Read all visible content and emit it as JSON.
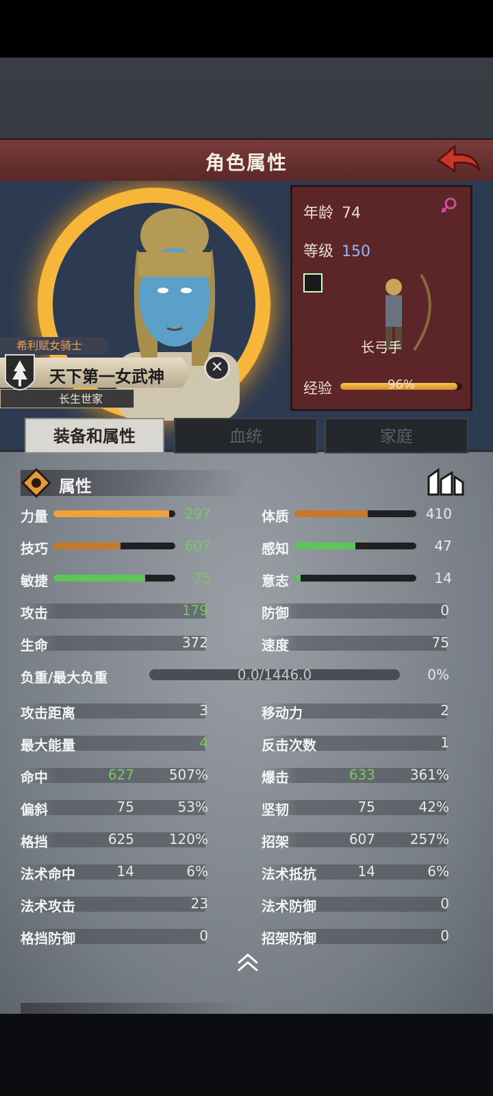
{
  "header": {
    "title": "角色属性"
  },
  "info": {
    "age_label": "年龄",
    "age": "74",
    "level_label": "等级",
    "level": "150",
    "class": "长弓手",
    "exp_label": "经验",
    "exp_text": "96%",
    "exp_fraction": 0.96
  },
  "character": {
    "title": "希利赋女骑士",
    "name": "天下第一女武神",
    "family": "长生世家"
  },
  "tabs": [
    "装备和属性",
    "血统",
    "家庭"
  ],
  "section": {
    "title": "属性"
  },
  "stats_bars": [
    {
      "label": "力量",
      "value": "297",
      "fill": 0.95,
      "color": "#f0a23a",
      "value_color": "green"
    },
    {
      "label": "体质",
      "value": "410",
      "fill": 0.6,
      "color": "#c47a2a",
      "value_color": "light"
    },
    {
      "label": "技巧",
      "value": "607",
      "fill": 0.55,
      "color": "#c47a2a",
      "value_color": "green"
    },
    {
      "label": "感知",
      "value": "47",
      "fill": 0.5,
      "color": "#5fc45a",
      "value_color": "light"
    },
    {
      "label": "敏捷",
      "value": "75",
      "fill": 0.75,
      "color": "#5fc45a",
      "value_color": "green"
    },
    {
      "label": "意志",
      "value": "14",
      "fill": 0.05,
      "color": "#5fc45a",
      "value_color": "light"
    }
  ],
  "stats_simple": [
    {
      "label": "攻击",
      "value": "179",
      "value_color": "green"
    },
    {
      "label": "防御",
      "value": "0",
      "value_color": "light"
    },
    {
      "label": "生命",
      "value": "372",
      "value_color": "light"
    },
    {
      "label": "速度",
      "value": "75",
      "value_color": "light"
    }
  ],
  "weight": {
    "label": "负重/最大负重",
    "value": "0.0/1446.0",
    "percent": "0%"
  },
  "stats_simple2": [
    {
      "label": "攻击距离",
      "value": "3",
      "value_color": "light"
    },
    {
      "label": "移动力",
      "value": "2",
      "value_color": "light"
    },
    {
      "label": "最大能量",
      "value": "4",
      "value_color": "green"
    },
    {
      "label": "反击次数",
      "value": "1",
      "value_color": "light"
    }
  ],
  "stats_pct": [
    {
      "label": "命中",
      "value": "627",
      "pct": "507%",
      "value_color": "green"
    },
    {
      "label": "爆击",
      "value": "633",
      "pct": "361%",
      "value_color": "green"
    },
    {
      "label": "偏斜",
      "value": "75",
      "pct": "53%",
      "value_color": "light"
    },
    {
      "label": "坚韧",
      "value": "75",
      "pct": "42%",
      "value_color": "light"
    },
    {
      "label": "格挡",
      "value": "625",
      "pct": "120%",
      "value_color": "light"
    },
    {
      "label": "招架",
      "value": "607",
      "pct": "257%",
      "value_color": "light"
    },
    {
      "label": "法术命中",
      "value": "14",
      "pct": "6%",
      "value_color": "light"
    },
    {
      "label": "法术抵抗",
      "value": "14",
      "pct": "6%",
      "value_color": "light"
    }
  ],
  "stats_simple3": [
    {
      "label": "法术攻击",
      "value": "23",
      "value_color": "light"
    },
    {
      "label": "法术防御",
      "value": "0",
      "value_color": "light"
    },
    {
      "label": "格挡防御",
      "value": "0",
      "value_color": "light"
    },
    {
      "label": "招架防御",
      "value": "0",
      "value_color": "light"
    }
  ]
}
